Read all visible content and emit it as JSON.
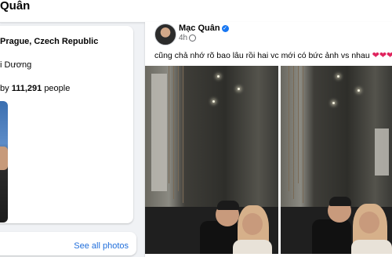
{
  "header": {
    "profile_name": "Quân"
  },
  "intro": {
    "lives_in_label": "Prague, Czech Republic",
    "from_label": "i Dương",
    "followers_prefix": "by",
    "followers_count": "111,291",
    "followers_suffix": "people"
  },
  "left_card_2": {
    "link_label": "See all photos"
  },
  "post": {
    "author": "Mạc Quân",
    "timestamp": "4h",
    "caption": "cũng chả nhớ rõ bao lâu rồi hai vc mới có bức ảnh vs nhau",
    "hearts": "❤❤❤"
  },
  "colors": {
    "accent": "#1877f2",
    "heart": "#e0245e",
    "background": "#f0f2f5"
  }
}
